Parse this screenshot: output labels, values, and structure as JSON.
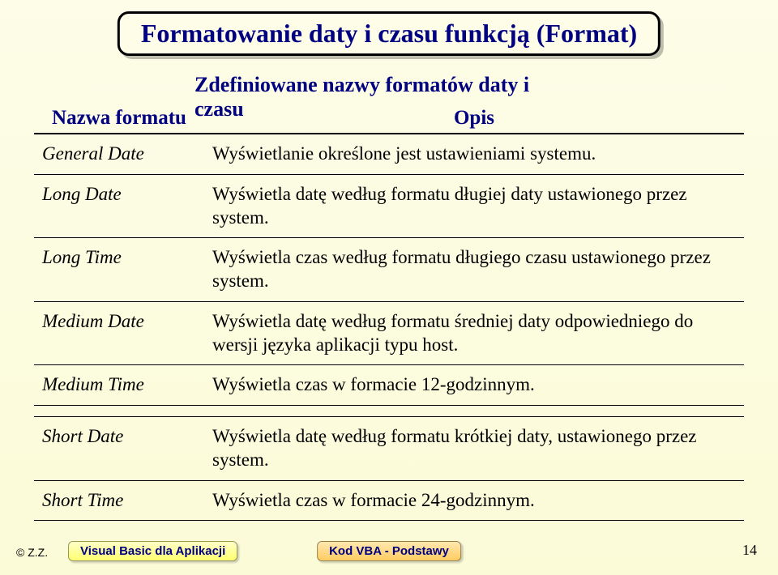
{
  "title": "Formatowanie daty i czasu funkcją (Format)",
  "subtitle": "Zdefiniowane nazwy formatów daty i czasu",
  "headers": {
    "name": "Nazwa formatu",
    "desc": "Opis"
  },
  "rows": [
    {
      "name": "General Date",
      "desc": "Wyświetlanie określone jest ustawieniami systemu."
    },
    {
      "name": "Long Date",
      "desc": "Wyświetla datę według formatu długiej daty ustawionego przez system."
    },
    {
      "name": "Long Time",
      "desc": "Wyświetla czas według formatu długiego czasu ustawionego przez system."
    },
    {
      "name": "Medium Date",
      "desc": "Wyświetla datę według formatu średniej daty odpowiedniego do wersji języka aplikacji typu host."
    },
    {
      "name": "Medium Time",
      "desc": "Wyświetla czas w formacie 12-godzinnym."
    }
  ],
  "rows2": [
    {
      "name": "Short Date",
      "desc": "Wyświetla datę według formatu krótkiej daty, ustawionego przez system."
    },
    {
      "name": "Short Time",
      "desc": "Wyświetla czas w formacie 24-godzinnym."
    }
  ],
  "footer": {
    "copyright": "© Z.Z.",
    "left_pill": "Visual Basic dla Aplikacji",
    "center_pill": "Kod VBA - Podstawy",
    "page": "14"
  }
}
